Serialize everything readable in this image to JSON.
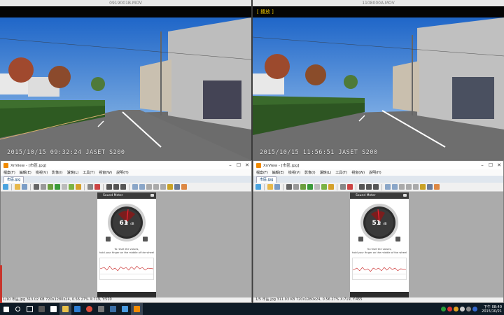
{
  "videos": {
    "left": {
      "title": "0919001B.MOV",
      "timestamp": "2015/10/15  09:32:24   JASET S200"
    },
    "right": {
      "title": "1108000A.MOV",
      "status": "[ 播放 ]",
      "timestamp": "2015/10/15  11:56:51   JASET S200"
    }
  },
  "xnview": {
    "title": "XnView - [市區.jpg]",
    "menu": [
      "檔案(F)",
      "編輯(E)",
      "檢視(V)",
      "影像(I)",
      "濾鏡(L)",
      "工具(T)",
      "視窗(W)",
      "說明(H)"
    ],
    "tab": "市區.jpg",
    "left_status": "1/10   市區.jpg   313.02 KB   720x1280x24, 0.56   27%   X:719, Y:510",
    "right_status": "1/5   市區.jpg   311.93 KB   720x1280x24, 0.56   27%   X:719, Y:455"
  },
  "sound_meter": {
    "header": "Sound Meter",
    "left_value": "61",
    "right_value": "51",
    "unit": "dB",
    "instructions": "To reset the values,\nhold your finger on the middle of the wheel"
  },
  "taskbar": {
    "time": "下午 08:40",
    "date": "2015/10/21"
  },
  "colors": {
    "accent": "#0078d7",
    "taskbar": "#0e1b26",
    "meter_needle": "#c0392b"
  }
}
